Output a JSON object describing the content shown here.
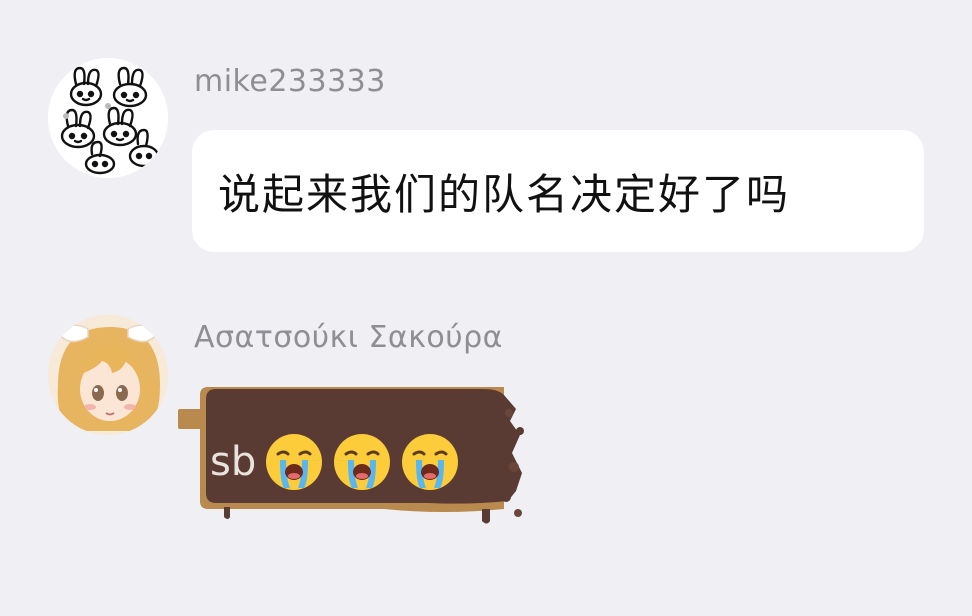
{
  "messages": [
    {
      "sender": "mike233333",
      "avatar": "rabbit-doodle-avatar",
      "text": "说起来我们的队名决定好了吗"
    },
    {
      "sender": "Ασατσούκι Σακούρα",
      "avatar": "anime-girl-avatar",
      "text": "sb",
      "emoji_count": 3,
      "emoji_icon": "loudly-crying-face-icon",
      "bubble_style": "chocolate-bar"
    }
  ],
  "colors": {
    "background": "#efeff4",
    "sender_name": "#8e8e93",
    "bubble": "#ffffff",
    "chocolate": "#5a3b33",
    "wrapper": "#b98a4e"
  }
}
